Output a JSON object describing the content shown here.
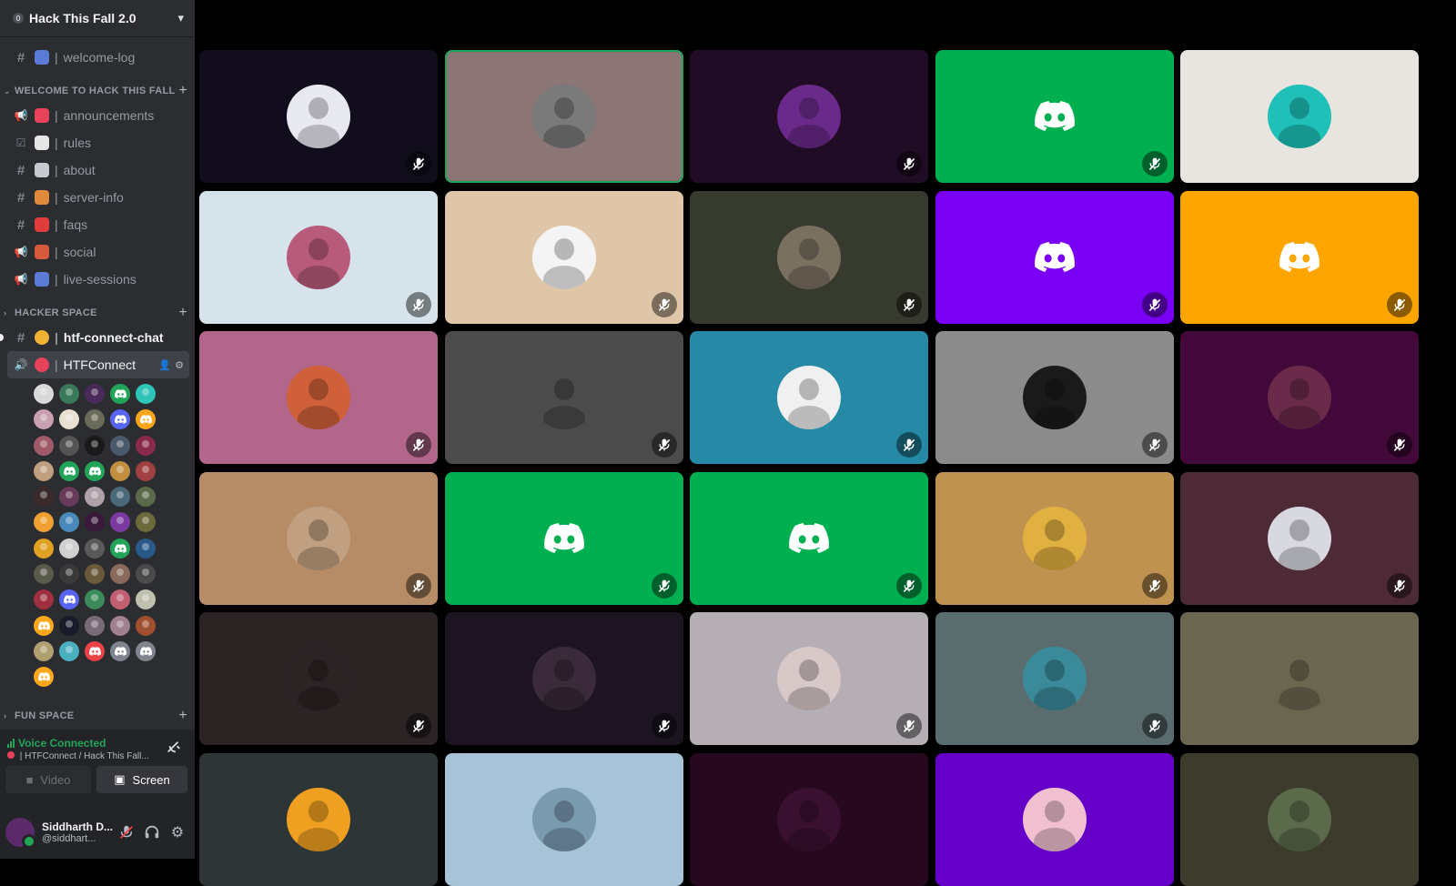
{
  "server": {
    "name": "Hack This Fall 2.0",
    "badge": "0"
  },
  "channels_top": [
    {
      "type": "#",
      "emoji_color": "#5b7bd6",
      "label": "welcome-log"
    }
  ],
  "categories": {
    "welcome": "WELCOME TO HACK THIS FALL",
    "hacker": "HACKER SPACE",
    "fun": "FUN SPACE"
  },
  "welcome_channels": [
    {
      "type": "📢",
      "emoji_color": "#e8425a",
      "label": "announcements"
    },
    {
      "type": "☑",
      "emoji_color": "#e6e6e6",
      "label": "rules"
    },
    {
      "type": "#",
      "emoji_color": "#c8c8d0",
      "label": "about"
    },
    {
      "type": "#",
      "emoji_color": "#e08a3c",
      "label": "server-info"
    },
    {
      "type": "#",
      "emoji_color": "#e03c3c",
      "label": "faqs"
    },
    {
      "type": "📢",
      "emoji_color": "#d65a3c",
      "label": "social"
    },
    {
      "type": "📢",
      "emoji_color": "#5b7bd6",
      "label": "live-sessions"
    }
  ],
  "hacker_channels": [
    {
      "type": "#",
      "emoji_color": "#f0b232",
      "label": "htf-connect-chat"
    }
  ],
  "voice_channel": {
    "type": "🔊",
    "emoji_color": "#e8425a",
    "label": "HTFConnect"
  },
  "voice_members": [
    "#d9d9d9",
    "#3a7a5a",
    "#4a2a5a",
    "#23a559",
    "#2ec4b6",
    "#c9a0b0",
    "#e8e0d0",
    "#6a6a5a",
    "#5865f2",
    "#faa61a",
    "#a05a6a",
    "#555",
    "#1a1a1a",
    "#4a5a6a",
    "#8a2a4a",
    "#c0a080",
    "#23a559",
    "#23a559",
    "#c09040",
    "#a04040",
    "#3a2a2a",
    "#6a3a5a",
    "#b0a0a8",
    "#4a6a7a",
    "#5a6a4a",
    "#f0a030",
    "#4a8aba",
    "#3a1a3a",
    "#7a3aa0",
    "#6a6a3a",
    "#e0a020",
    "#d0d0d0",
    "#5a5a5a",
    "#23a559",
    "#2a5a8a",
    "#5a5a4a",
    "#3a3a3a",
    "#6a5a3a",
    "#8a6a5a",
    "#4a4a4a",
    "#a03040",
    "#5865f2",
    "#3a8a5a",
    "#c06070",
    "#c0c0b0",
    "#faa61a",
    "#1a1a2a",
    "#7a6a7a",
    "#a08090",
    "#a05030",
    "#b0a070",
    "#4ab0c0",
    "#ed4245",
    "#80848e",
    "#80848e",
    "#faa61a"
  ],
  "voice_members_logo_idx": [
    3,
    8,
    9,
    16,
    17,
    33,
    41,
    45,
    52,
    53,
    54,
    55
  ],
  "voice_panel": {
    "status": "Voice Connected",
    "subtitle": "| HTFConnect / Hack This Fall...",
    "video_label": "Video",
    "screen_label": "Screen"
  },
  "user": {
    "name": "Siddharth D...",
    "handle": "@siddhart...",
    "avatar_color": "#5a2a6a"
  },
  "tiles": [
    {
      "bg": "#110d1c",
      "kind": "photo",
      "av": "#e8e8f0",
      "speaking": false,
      "muted": true
    },
    {
      "bg": "#8b7575",
      "kind": "photo",
      "av": "#7a7a7a",
      "speaking": true,
      "muted": false
    },
    {
      "bg": "#210c26",
      "kind": "photo",
      "av": "#6a2a8a",
      "speaking": false,
      "muted": true
    },
    {
      "bg": "#00b050",
      "kind": "logo",
      "av": "",
      "speaking": false,
      "muted": true
    },
    {
      "bg": "#e8e4e0",
      "kind": "photo",
      "av": "#1ec0b8",
      "speaking": false,
      "muted": false
    },
    {
      "bg": "#d6e3ea",
      "kind": "photo",
      "av": "#b85a7a",
      "speaking": false,
      "muted": true
    },
    {
      "bg": "#dfc6a8",
      "kind": "photo",
      "av": "#f4f4f4",
      "speaking": false,
      "muted": true
    },
    {
      "bg": "#363a2f",
      "kind": "photo",
      "av": "#7a7060",
      "speaking": false,
      "muted": true
    },
    {
      "bg": "#7a00f5",
      "kind": "logo",
      "av": "",
      "speaking": false,
      "muted": true
    },
    {
      "bg": "#ffa500",
      "kind": "logo",
      "av": "",
      "speaking": false,
      "muted": true
    },
    {
      "bg": "#b2668a",
      "kind": "photo",
      "av": "#d0603a",
      "speaking": false,
      "muted": true
    },
    {
      "bg": "#4b4b4b",
      "kind": "photo",
      "av": "#4b4b4b",
      "speaking": false,
      "muted": true
    },
    {
      "bg": "#268aa6",
      "kind": "photo",
      "av": "#f0f0f0",
      "speaking": false,
      "muted": true
    },
    {
      "bg": "#8b8b8b",
      "kind": "photo",
      "av": "#1a1a1a",
      "speaking": false,
      "muted": true
    },
    {
      "bg": "#44093b",
      "kind": "photo",
      "av": "#6a2a4a",
      "speaking": false,
      "muted": true
    },
    {
      "bg": "#b68c66",
      "kind": "photo",
      "av": "#c0a080",
      "speaking": false,
      "muted": true
    },
    {
      "bg": "#00b050",
      "kind": "logo",
      "av": "",
      "speaking": false,
      "muted": true
    },
    {
      "bg": "#00b050",
      "kind": "logo",
      "av": "",
      "speaking": false,
      "muted": true
    },
    {
      "bg": "#bf9250",
      "kind": "photo",
      "av": "#e0b040",
      "speaking": false,
      "muted": true
    },
    {
      "bg": "#4d2a36",
      "kind": "photo",
      "av": "#d8d8e0",
      "speaking": false,
      "muted": true
    },
    {
      "bg": "#2b2324",
      "kind": "photo",
      "av": "#2b2324",
      "speaking": false,
      "muted": true
    },
    {
      "bg": "#1d1421",
      "kind": "photo",
      "av": "#3a2a3a",
      "speaking": false,
      "muted": true
    },
    {
      "bg": "#b5afb5",
      "kind": "photo",
      "av": "#d8c8c8",
      "speaking": false,
      "muted": true
    },
    {
      "bg": "#5a6c6e",
      "kind": "photo",
      "av": "#3a8a9a",
      "speaking": false,
      "muted": true
    },
    {
      "bg": "#6b6650",
      "kind": "photo",
      "av": "#6b6650",
      "speaking": false,
      "muted": false
    },
    {
      "bg": "#2e3537",
      "kind": "photo",
      "av": "#f0a020",
      "speaking": false,
      "muted": false
    },
    {
      "bg": "#a6c3d7",
      "kind": "photo",
      "av": "#7a9ab0",
      "speaking": false,
      "muted": false
    },
    {
      "bg": "#26081f",
      "kind": "photo",
      "av": "#3a1030",
      "speaking": false,
      "muted": false
    },
    {
      "bg": "#6600c8",
      "kind": "photo",
      "av": "#f0c0d0",
      "speaking": false,
      "muted": false
    },
    {
      "bg": "#3d3b2b",
      "kind": "photo",
      "av": "#5a6a4a",
      "speaking": false,
      "muted": false
    }
  ]
}
